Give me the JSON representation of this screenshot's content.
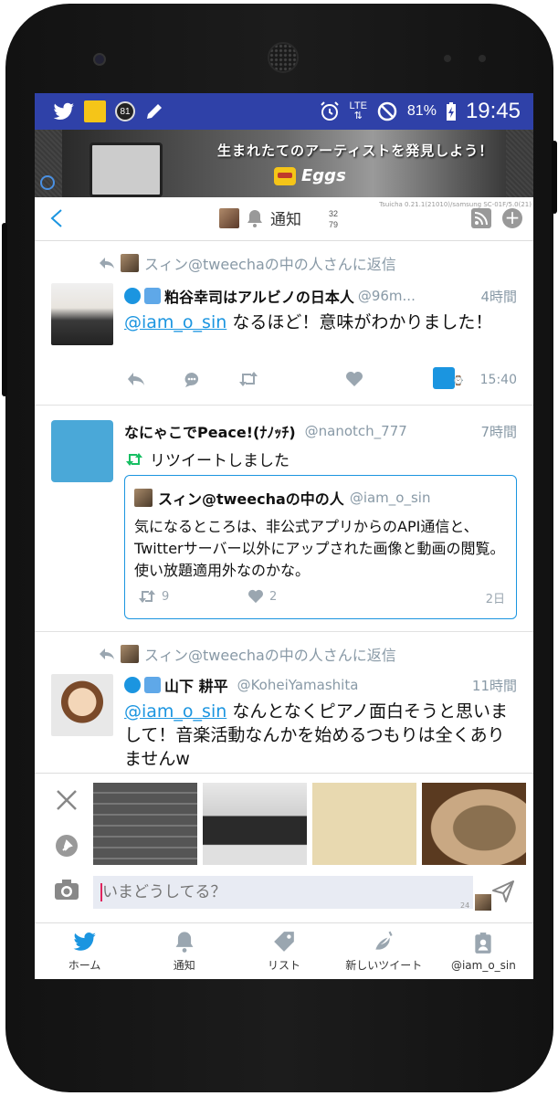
{
  "status_bar": {
    "notification_count": "81",
    "network": "LTE",
    "battery": "81%",
    "time": "19:45"
  },
  "banner": {
    "text": "生まれたてのアーティストを発見しよう！",
    "logo_text": "Eggs",
    "version": "Tsuicha 0.21.1(21010)/samsung SC-01F/5.0(21)"
  },
  "header": {
    "title": "通知",
    "count_top": "32",
    "count_bottom": "79"
  },
  "tweets": [
    {
      "reply_to": "スィン@tweechaの中の人さんに返信",
      "name": "粕谷幸司はアルビノの日本人",
      "handle": "@96m...",
      "time": "4時間",
      "mention": "@iam_o_sin",
      "text": " なるほど！意味がわかりました！",
      "timestamp": "15:40"
    },
    {
      "name": "なにゃこでPeace!(ﾅﾉｯﾁ)",
      "handle": "@nanotch_777",
      "time": "7時間",
      "retweet_label": "リツイートしました",
      "quote": {
        "name": "スィン@tweechaの中の人",
        "handle": "@iam_o_sin",
        "text": "気になるところは、非公式アプリからのAPI通信と、Twitterサーバー以外にアップされた画像と動画の閲覧。使い放題適用外なのかな。",
        "retweets": "9",
        "likes": "2",
        "time": "2日"
      }
    },
    {
      "reply_to": "スィン@tweechaの中の人さんに返信",
      "name": "山下 耕平",
      "handle": "@KoheiYamashita",
      "time": "11時間",
      "mention": "@iam_o_sin",
      "text": " なんとなくピアノ面白そうと思いまして！音楽活動なんかを始めるつもりは全くありませんw"
    }
  ],
  "compose": {
    "placeholder": "いまどうしてる？",
    "char_count": "24"
  },
  "bottom_nav": [
    {
      "label": "ホーム",
      "icon": "bird-icon"
    },
    {
      "label": "通知",
      "icon": "bell-icon"
    },
    {
      "label": "リスト",
      "icon": "tag-icon"
    },
    {
      "label": "新しいツイート",
      "icon": "quill-bird-icon"
    },
    {
      "label": "@iam_o_sin",
      "icon": "profile-card-icon"
    }
  ],
  "colors": {
    "status_bar": "#2f41a8",
    "link": "#1b95e0",
    "retweet_green": "#17bf63",
    "nav_blue": "#1b95e0"
  }
}
